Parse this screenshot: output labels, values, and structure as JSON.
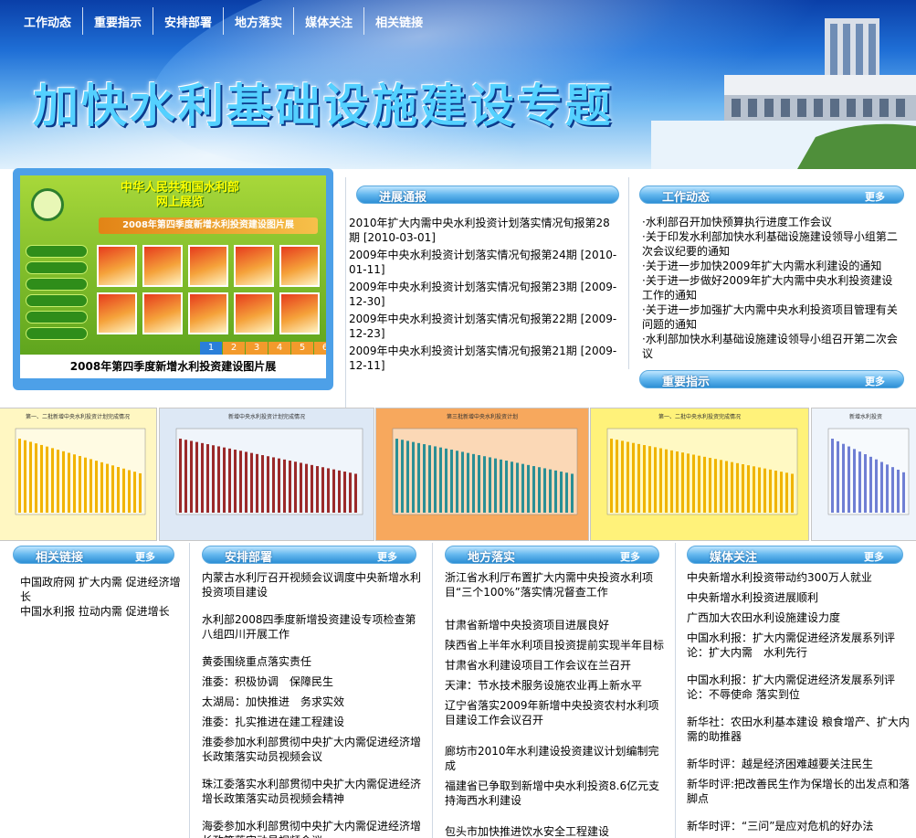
{
  "nav": [
    "工作动态",
    "重要指示",
    "安排部署",
    "地方落实",
    "媒体关注",
    "相关链接"
  ],
  "banner_title": "加快水利基础设施建设专题",
  "exhibit": {
    "header_line1": "中华人民共和国水利部",
    "header_line2": "网上展览",
    "banner": "2008年第四季度新增水利投资建设图片展",
    "pages": [
      "1",
      "2",
      "3",
      "4",
      "5",
      "6"
    ],
    "caption": "2008年第四季度新增水利投资建设图片展"
  },
  "progress": {
    "title": "进展通报",
    "items": [
      "2010年扩大内需中央水利投资计划落实情况旬报第28期 [2010-03-01]",
      "2009年中央水利投资计划落实情况旬报第24期 [2010-01-11]",
      "2009年中央水利投资计划落实情况旬报第23期 [2009-12-30]",
      "2009年中央水利投资计划落实情况旬报第22期 [2009-12-23]",
      "2009年中央水利投资计划落实情况旬报第21期 [2009-12-11]"
    ]
  },
  "work": {
    "title": "工作动态",
    "more": "更多",
    "items": [
      "·水利部召开加快预算执行进度工作会议",
      "·关于印发水利部加快水利基础设施建设领导小组第二次会议纪要的通知",
      "·关于进一步加快2009年扩大内需水利建设的通知",
      "·关于进一步做好2009年扩大内需中央水利投资建设工作的通知",
      "·关于进一步加强扩大内需中央水利投资项目管理有关问题的通知",
      "·水利部加快水利基础设施建设领导小组召开第二次会议"
    ]
  },
  "instructions": {
    "title": "重要指示",
    "more": "更多"
  },
  "charts": [
    {
      "bg": "#fff7c2",
      "bar": "#f2b400",
      "title": "第一、二批新增中央水利投资计划完成情况"
    },
    {
      "bg": "#dde8f5",
      "bar": "#9b2a2a",
      "title": "新增中央水利投资计划完成情况"
    },
    {
      "bg": "#f7a85d",
      "bar": "#2a8f95",
      "title": "第三批新增中央水利投资计划"
    },
    {
      "bg": "#fff27a",
      "bar": "#f0b400",
      "title": "第一、二批中央水利投资完成情况"
    },
    {
      "bg": "#eef4fb",
      "bar": "#6f7fd4",
      "title": "新增水利投资"
    }
  ],
  "links": {
    "title": "相关链接",
    "more": "更多",
    "items": [
      "中国政府网 扩大内需 促进经济增长",
      "中国水利报 拉动内需 促进增长"
    ]
  },
  "deploy": {
    "title": "安排部署",
    "more": "更多",
    "items": [
      "内蒙古水利厅召开视频会议调度中央新增水利投资项目建设",
      "水利部2008四季度新增投资建设专项检查第八组四川开展工作",
      "黄委围绕重点落实责任",
      "淮委：积极协调　保障民生",
      "太湖局：加快推进　务求实效",
      "淮委：扎实推进在建工程建设",
      "淮委参加水利部贯彻中央扩大内需促进经济增长政策落实动员视频会议",
      "珠江委落实水利部贯彻中央扩大内需促进经济增长政策落实动员视频会精神",
      "海委参加水利部贯彻中央扩大内需促进经济增长政策落实动员视频会议"
    ]
  },
  "local": {
    "title": "地方落实",
    "more": "更多",
    "items": [
      "浙江省水利厅布置扩大内需中央投资水利项目“三个100%”落实情况督查工作",
      "甘肃省新增中央投资项目进展良好",
      "陕西省上半年水利项目投资提前实现半年目标",
      "甘肃省水利建设项目工作会议在兰召开",
      "天津：节水技术服务设施农业再上新水平",
      "辽宁省落实2009年新增中央投资农村水利项目建设工作会议召开",
      "廊坊市2010年水利建设投资建议计划编制完成",
      "福建省已争取到新增中央水利投资8.6亿元支持海西水利建设",
      "包头市加快推进饮水安全工程建设"
    ]
  },
  "media": {
    "title": "媒体关注",
    "more": "更多",
    "items": [
      "中央新增水利投资带动约300万人就业",
      "中央新增水利投资进展顺利",
      "广西加大农田水利设施建设力度",
      "中国水利报：扩大内需促进经济发展系列评论：扩大内需　水利先行",
      "中国水利报：扩大内需促进经济发展系列评论：不辱使命 落实到位",
      "新华社：农田水利基本建设 粮食增产、扩大内需的助推器",
      "新华时评：越是经济困难越要关注民生",
      "新华时评:把改善民生作为保增长的出发点和落脚点",
      "新华时评：“三问”是应对危机的好办法"
    ]
  }
}
